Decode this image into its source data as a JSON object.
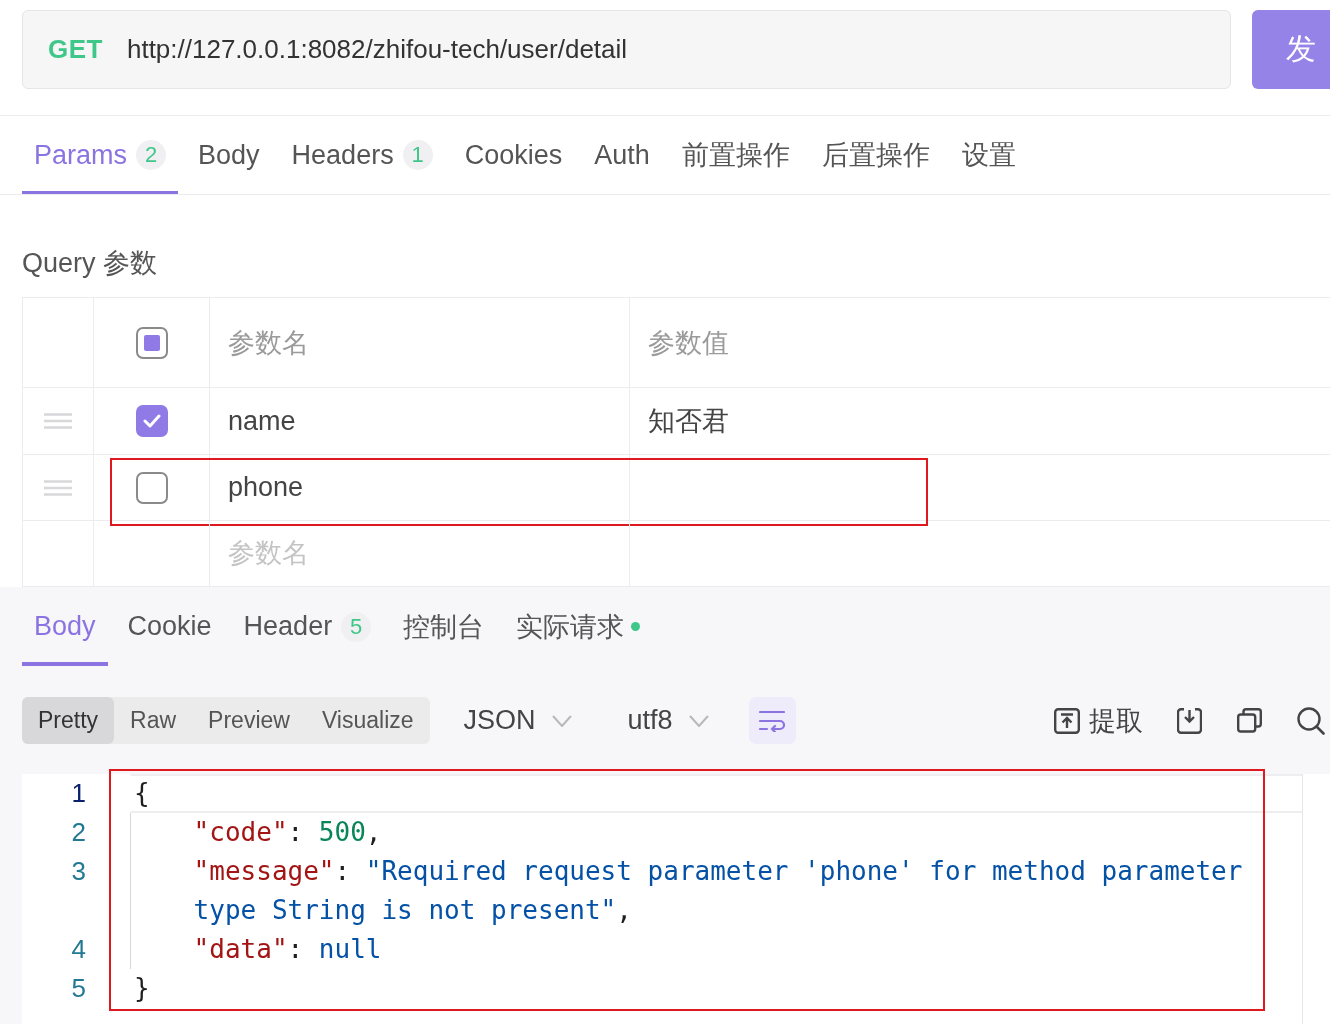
{
  "request": {
    "method": "GET",
    "url": "http://127.0.0.1:8082/zhifou-tech/user/detail",
    "send_label": "发"
  },
  "request_tabs": [
    {
      "label": "Params",
      "badge": "2",
      "selected": true
    },
    {
      "label": "Body",
      "selected": false
    },
    {
      "label": "Headers",
      "badge": "1",
      "selected": false
    },
    {
      "label": "Cookies",
      "selected": false
    },
    {
      "label": "Auth",
      "selected": false
    },
    {
      "label": "前置操作",
      "selected": false
    },
    {
      "label": "后置操作",
      "selected": false
    },
    {
      "label": "设置",
      "selected": false
    }
  ],
  "query": {
    "title": "Query 参数",
    "columns": [
      "参数名",
      "参数值"
    ],
    "select_all": {
      "checked": false,
      "partial": true
    },
    "rows": [
      {
        "name": "name",
        "value": "知否君",
        "checked": true,
        "highlighted": false
      },
      {
        "name": "phone",
        "checked": false,
        "highlighted": true
      }
    ],
    "new_row": {
      "placeholder": "参数名"
    }
  },
  "response_tabs": [
    {
      "label": "Body",
      "selected": true
    },
    {
      "label": "Cookie",
      "selected": false
    },
    {
      "label": "Header",
      "badge": "5",
      "selected": false
    },
    {
      "label": "控制台",
      "selected": false
    },
    {
      "label": "实际请求",
      "status_dot": true,
      "selected": false
    }
  ],
  "view_modes": [
    {
      "label": "Pretty",
      "selected": true
    },
    {
      "label": "Raw",
      "selected": false
    },
    {
      "label": "Preview",
      "selected": false
    },
    {
      "label": "Visualize",
      "selected": false
    }
  ],
  "format_select": {
    "value": "JSON"
  },
  "encoding_select": {
    "value": "utf8"
  },
  "word_wrap": {
    "on": true
  },
  "extract_button": {
    "label": "提取"
  },
  "code": {
    "highlighted": true,
    "lines": [
      {
        "number": "1",
        "current": true,
        "indented": false,
        "tokens": [
          {
            "kind": "punct",
            "text": "{"
          }
        ]
      },
      {
        "number": "2",
        "current": false,
        "indented": true,
        "tokens": [
          {
            "kind": "key",
            "text": "\"code\""
          },
          {
            "kind": "punct",
            "text": ": "
          },
          {
            "kind": "number",
            "text": "500"
          },
          {
            "kind": "punct",
            "text": ","
          }
        ]
      },
      {
        "number": "3",
        "current": false,
        "indented": true,
        "tokens": [
          {
            "kind": "key",
            "text": "\"message\""
          },
          {
            "kind": "punct",
            "text": ": "
          },
          {
            "kind": "string",
            "text": "\"Required request parameter 'phone' for method parameter type String is not present\""
          },
          {
            "kind": "punct",
            "text": ","
          }
        ]
      },
      {
        "number": "4",
        "current": false,
        "indented": true,
        "tokens": [
          {
            "kind": "key",
            "text": "\"data\""
          },
          {
            "kind": "punct",
            "text": ": "
          },
          {
            "kind": "keyword",
            "text": "null"
          }
        ]
      },
      {
        "number": "5",
        "current": false,
        "indented": false,
        "tokens": [
          {
            "kind": "punct",
            "text": "}"
          }
        ]
      }
    ]
  }
}
